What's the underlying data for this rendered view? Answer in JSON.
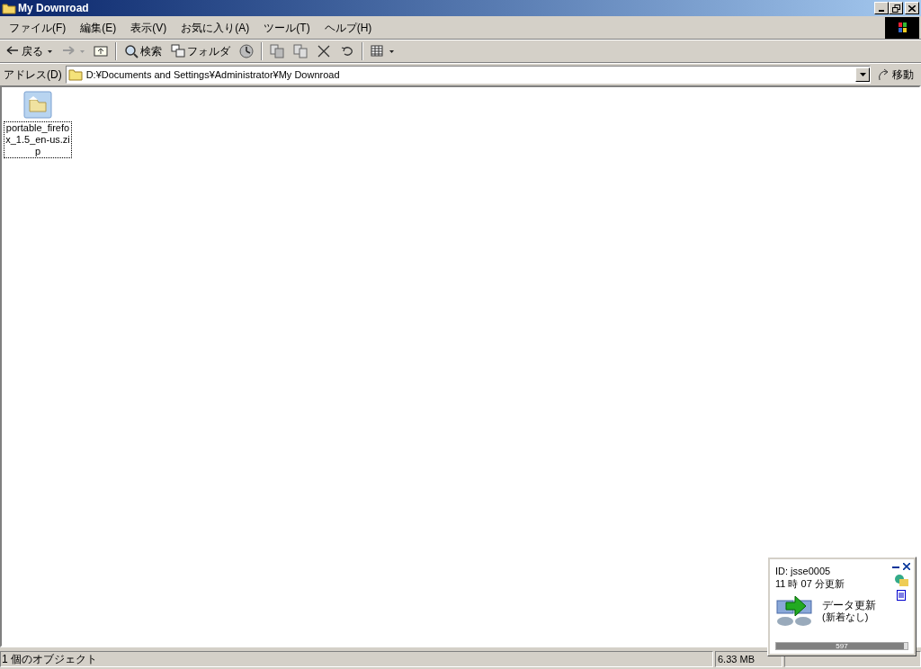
{
  "window": {
    "title": "My Downroad"
  },
  "menu": [
    "ファイル(F)",
    "編集(E)",
    "表示(V)",
    "お気に入り(A)",
    "ツール(T)",
    "ヘルプ(H)"
  ],
  "toolbar": [
    {
      "kind": "back",
      "label": "戻る",
      "disabled": false
    },
    {
      "kind": "forward",
      "disabled": true
    },
    {
      "kind": "up"
    },
    {
      "kind": "separator"
    },
    {
      "kind": "search",
      "label": "検索"
    },
    {
      "kind": "folders",
      "label": "フォルダ"
    },
    {
      "kind": "history"
    },
    {
      "kind": "separator"
    },
    {
      "kind": "move"
    },
    {
      "kind": "copy"
    },
    {
      "kind": "delete"
    },
    {
      "kind": "undo"
    },
    {
      "kind": "separator"
    },
    {
      "kind": "views"
    }
  ],
  "address": {
    "label": "アドレス(D)",
    "value": "D:¥Documents and Settings¥Administrator¥My Downroad",
    "go": "移動"
  },
  "files": [
    {
      "name": "portable_firefox_1.5_en-us.zip",
      "selected": true
    }
  ],
  "status_bar": {
    "objects": "1 個のオブジェクト",
    "size": "6.33 MB"
  },
  "popup": {
    "id": "ID: jsse0005",
    "updated": "11 時 07 分更新",
    "message": "データ更新",
    "detail": "(新着なし)",
    "progress": {
      "level": 0.97,
      "reading": "597"
    }
  }
}
